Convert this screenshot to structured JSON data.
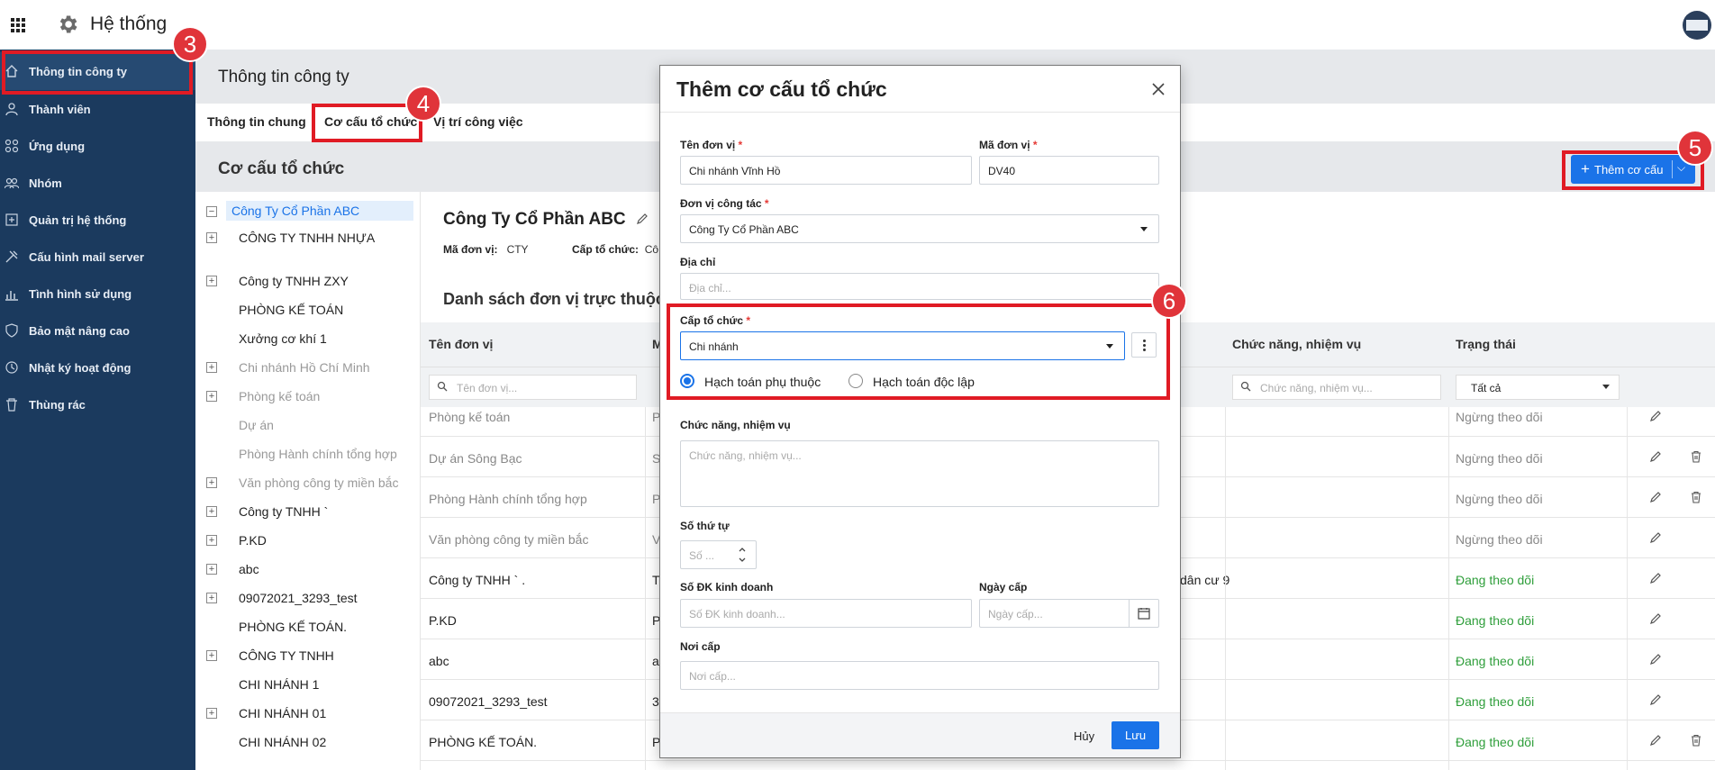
{
  "app": {
    "title": "Hệ thống"
  },
  "sidebar": {
    "items": [
      {
        "label": "Thông tin công ty",
        "icon": "home-icon"
      },
      {
        "label": "Thành viên",
        "icon": "user-icon"
      },
      {
        "label": "Ứng dụng",
        "icon": "apps-icon"
      },
      {
        "label": "Nhóm",
        "icon": "group-icon"
      },
      {
        "label": "Quản trị hệ thống",
        "icon": "admin-icon"
      },
      {
        "label": "Cấu hình mail server",
        "icon": "tools-icon"
      },
      {
        "label": "Tình hình sử dụng",
        "icon": "chart-icon"
      },
      {
        "label": "Bảo mật nâng cao",
        "icon": "shield-icon"
      },
      {
        "label": "Nhật ký hoạt động",
        "icon": "history-icon"
      },
      {
        "label": "Thùng rác",
        "icon": "trash-icon"
      }
    ]
  },
  "page": {
    "title": "Thông tin công ty"
  },
  "tabs": [
    {
      "label": "Thông tin chung"
    },
    {
      "label": "Cơ cấu tổ chức"
    },
    {
      "label": "Vị trí công việc"
    }
  ],
  "section": {
    "title": "Cơ cấu tổ chức",
    "add_button": "Thêm cơ cấu"
  },
  "tree": {
    "items": [
      {
        "label": "Công Ty Cổ Phần ABC",
        "toggle": "−"
      },
      {
        "label": "CÔNG TY TNHH NHỰA",
        "toggle": "+"
      },
      {
        "label": "Công ty TNHH ZXY",
        "toggle": "+"
      },
      {
        "label": "PHÒNG KẾ TOÁN",
        "toggle": ""
      },
      {
        "label": "Xưởng cơ khí 1",
        "toggle": ""
      },
      {
        "label": "Chi nhánh Hồ Chí Minh",
        "toggle": "+"
      },
      {
        "label": "Phòng kế toán",
        "toggle": "+"
      },
      {
        "label": "Dự án",
        "toggle": ""
      },
      {
        "label": "Phòng Hành chính tổng hợp",
        "toggle": ""
      },
      {
        "label": "Văn phòng công ty miền bắc",
        "toggle": "+"
      },
      {
        "label": "Công ty TNHH `",
        "toggle": "+"
      },
      {
        "label": "P.KD",
        "toggle": "+"
      },
      {
        "label": "abc",
        "toggle": "+"
      },
      {
        "label": "09072021_3293_test",
        "toggle": "+"
      },
      {
        "label": "PHÒNG KẾ TOÁN.",
        "toggle": ""
      },
      {
        "label": "CÔNG TY TNHH",
        "toggle": "+"
      },
      {
        "label": "CHI NHÁNH 1",
        "toggle": ""
      },
      {
        "label": "CHI NHÁNH 01",
        "toggle": "+"
      },
      {
        "label": "CHI NHÁNH 02",
        "toggle": ""
      }
    ]
  },
  "org": {
    "name": "Công Ty Cổ Phần ABC",
    "code_label": "Mã đơn vị:",
    "code": "CTY",
    "level_label": "Cấp tổ chức:",
    "level": "Cô"
  },
  "list": {
    "title": "Danh sách đơn vị trực thuộc",
    "columns": {
      "name": "Tên đơn vị",
      "code": "M",
      "func": "Chức năng, nhiệm vụ",
      "status": "Trạng thái"
    },
    "filters": {
      "name_ph": "Tên đơn vị...",
      "func_ph": "Chức năng, nhiệm vụ...",
      "status": "Tất cả"
    },
    "rows": [
      {
        "name": "Phòng kế toán",
        "code": "P",
        "func": "",
        "status": "Ngừng theo dõi"
      },
      {
        "name": "Dự án Sông Bạc",
        "code": "S",
        "func": "",
        "status": "Ngừng theo dõi"
      },
      {
        "name": "Phòng Hành chính tổng hợp",
        "code": "P",
        "func": "",
        "status": "Ngừng theo dõi"
      },
      {
        "name": "Văn phòng công ty miền bắc",
        "code": "V",
        "func": "",
        "status": "Ngừng theo dõi"
      },
      {
        "name": "Công ty TNHH `         .",
        "code": "T",
        "func": "dân cư 9",
        "status": "Đang theo dõi"
      },
      {
        "name": "P.KD",
        "code": "P",
        "func": "",
        "status": "Đang theo dõi"
      },
      {
        "name": "abc",
        "code": "a",
        "func": "",
        "status": "Đang theo dõi"
      },
      {
        "name": "09072021_3293_test",
        "code": "3",
        "func": "",
        "status": "Đang theo dõi"
      },
      {
        "name": "PHÒNG KẾ TOÁN.",
        "code": "P",
        "func": "",
        "status": "Đang theo dõi"
      }
    ]
  },
  "modal": {
    "title": "Thêm cơ cấu tổ chức",
    "unit_name_label": "Tên đơn vị",
    "unit_name_value": "Chi nhánh Vĩnh Hồ",
    "unit_code_label": "Mã đơn vị",
    "unit_code_value": "DV40",
    "work_unit_label": "Đơn vị công tác",
    "work_unit_value": "Công Ty Cổ Phần ABC",
    "address_label": "Địa chỉ",
    "address_ph": "Địa chỉ...",
    "level_label": "Cấp tổ chức",
    "level_value": "Chi nhánh",
    "radio_dependent": "Hạch toán phụ thuộc",
    "radio_independent": "Hạch toán độc lập",
    "func_label": "Chức năng, nhiệm vụ",
    "func_ph": "Chức năng, nhiệm vụ...",
    "order_label": "Số thứ tự",
    "order_ph": "Số ...",
    "reg_label": "Số ĐK kinh doanh",
    "reg_ph": "Số ĐK kinh doanh...",
    "date_label": "Ngày cấp",
    "date_ph": "Ngày cấp...",
    "place_label": "Nơi cấp",
    "place_ph": "Nơi cấp...",
    "required_mark": "*",
    "cancel": "Hủy",
    "save": "Lưu"
  },
  "annotations": {
    "b3": "3",
    "b4": "4",
    "b5": "5",
    "b6": "6"
  },
  "colors": {
    "sidebar": "#1b3a5e",
    "accent": "#1a73e8",
    "highlight": "#e01b24",
    "active_status": "#2e9e3a",
    "inactive_status": "#888888"
  }
}
